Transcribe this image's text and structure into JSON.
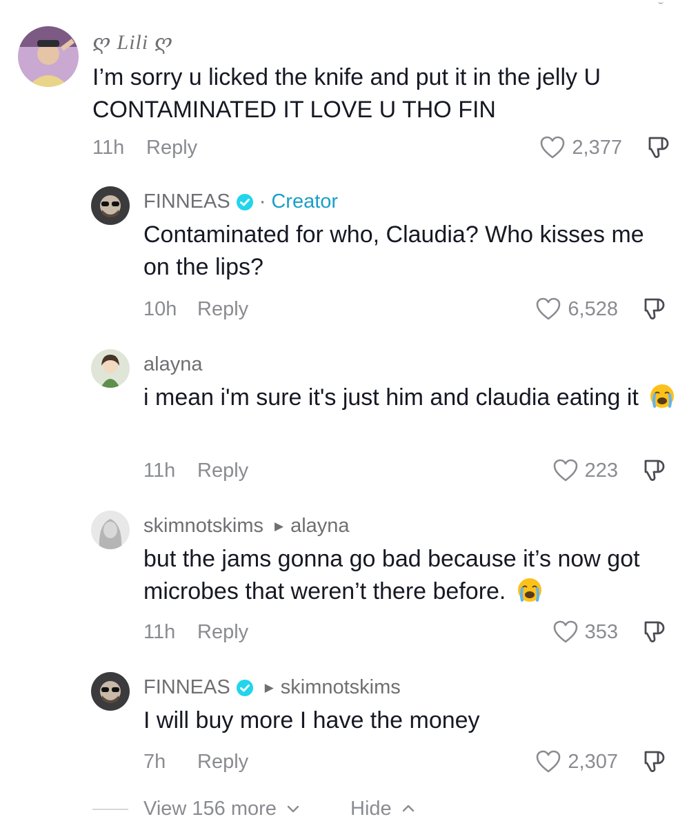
{
  "colors": {
    "text": "#161823",
    "muted": "#8a8b91",
    "creator": "#1a9ec9",
    "verified": "#20d5ec"
  },
  "comments": [
    {
      "user": "ღ Lili ღ",
      "avatar": "user-avatar",
      "text": "I’m sorry u licked the knife and put it in the jelly U CONTAMINATED IT LOVE U THO FIN",
      "time": "11h",
      "reply": "Reply",
      "likes": "2,377"
    },
    {
      "user": "FINNEAS",
      "badge": "verified-icon",
      "separator": "·",
      "role": "Creator",
      "text": "Contaminated for who, Claudia? Who kisses me on the lips?",
      "time": "10h",
      "reply": "Reply",
      "likes": "6,528"
    },
    {
      "user": "alayna",
      "text": "i mean i'm sure it's just him and claudia eating it",
      "emoji": "loudly-crying-face",
      "time": "11h",
      "reply": "Reply",
      "likes": "223"
    },
    {
      "user": "skimnotskims",
      "reply_to": "alayna",
      "text": "but the jams gonna go bad because it’s now got microbes that weren’t there before.",
      "emoji": "loudly-crying-face",
      "time": "11h",
      "reply": "Reply",
      "likes": "353"
    },
    {
      "user": "FINNEAS",
      "badge": "verified-icon",
      "reply_to": "skimnotskims",
      "text": "I will buy more I have the money",
      "time": "7h",
      "reply": "Reply",
      "likes": "2,307"
    }
  ],
  "footer": {
    "view_more": "View 156 more",
    "hide": "Hide"
  }
}
